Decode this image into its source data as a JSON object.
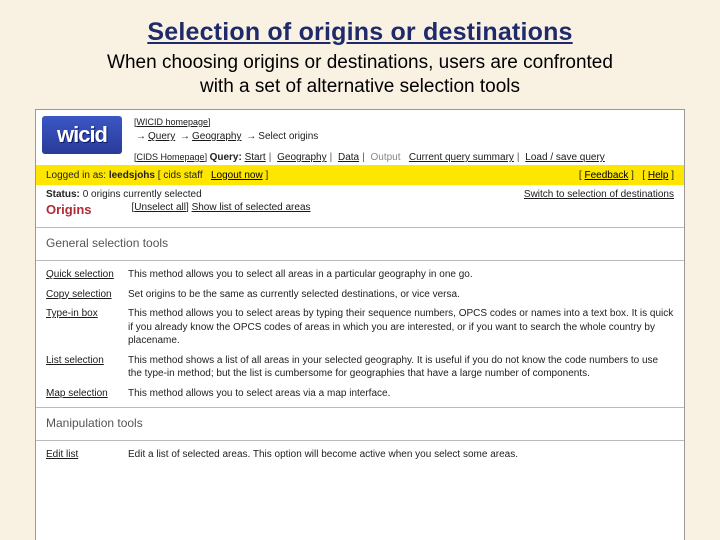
{
  "title": "Selection of origins or destinations",
  "lead": "When choosing origins or destinations, users are confronted with a set of alternative selection tools",
  "logo": "wicid",
  "top_links": {
    "home": "WICID homepage",
    "cids": "CIDS Homepage"
  },
  "crumb": {
    "a": "Query",
    "b": "Geography",
    "c": "Select origins"
  },
  "nav": {
    "query_label": "Query:",
    "start": "Start",
    "geography": "Geography",
    "data": "Data",
    "output": "Output",
    "summary": "Current query summary",
    "load": "Load / save query"
  },
  "yellowbar": {
    "prefix": "Logged in as:",
    "user": "leedsjohs",
    "role": "cids staff",
    "logout": "Logout now",
    "feedback": "Feedback",
    "help": "Help"
  },
  "status": {
    "left_label": "Status:",
    "left_text": "0 origins currently selected",
    "right": "Switch to selection of destinations"
  },
  "unselect": {
    "link": "Unselect all",
    "show": "Show list of selected areas"
  },
  "origins_heading": "Origins",
  "section_general": "General selection tools",
  "tools": {
    "quick": {
      "name": "Quick selection",
      "desc": "This method allows you to select all areas in a particular geography in one go."
    },
    "copy": {
      "name": "Copy selection",
      "desc": "Set origins to be the same as currently selected destinations, or vice versa."
    },
    "type": {
      "name": "Type-in box",
      "desc": "This method allows you to select areas by typing their sequence numbers, OPCS codes or names into a text box. It is quick if you already know the OPCS codes of areas in which you are interested, or if you want to search the whole country by placename."
    },
    "list": {
      "name": "List selection",
      "desc": "This method shows a list of all areas in your selected geography. It is useful if you do not know the code numbers to use the type-in method; but the list is cumbersome for geographies that have a large number of components."
    },
    "map": {
      "name": "Map selection",
      "desc": "This method allows you to select areas via a map interface."
    }
  },
  "section_manip": "Manipulation tools",
  "edit": {
    "name": "Edit list",
    "desc": "Edit a list of selected areas. This option will become active when you select some areas."
  }
}
